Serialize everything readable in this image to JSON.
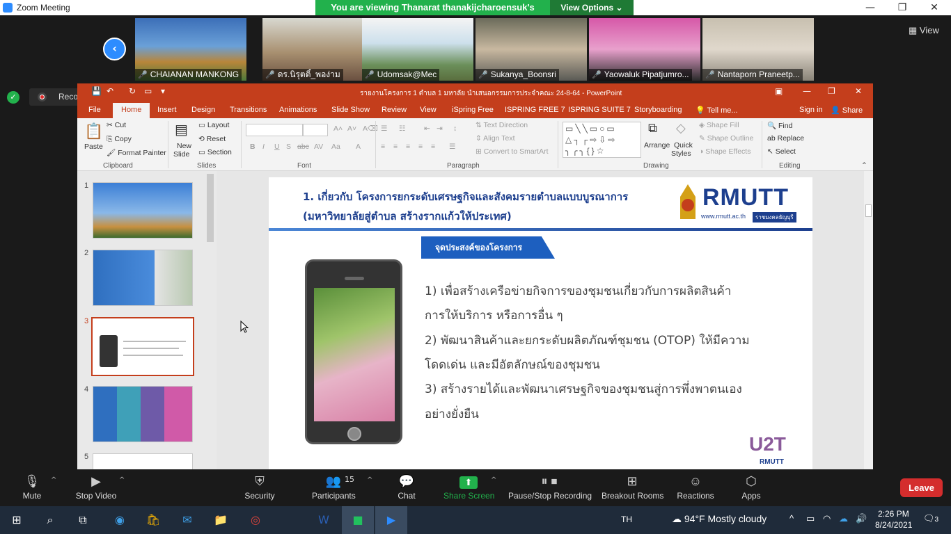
{
  "zoom": {
    "window_title": "Zoom Meeting",
    "viewing_banner": "You are viewing Thanarat thanakijcharoensuk's screen",
    "view_options": "View Options",
    "gallery_view_label": "View",
    "recording_label": "Recording..."
  },
  "participants": [
    {
      "name": "CHAIANAN MANKONG"
    },
    {
      "name": "ดร.นิรุตติ์_พอง่าม"
    },
    {
      "name": "Udomsak@Mec"
    },
    {
      "name": "Sukanya_Boonsri"
    },
    {
      "name": "Yaowaluk Pipatjumro..."
    },
    {
      "name": "Nantaporn Praneetp..."
    }
  ],
  "ppt": {
    "doc_title": "รายงานโครงการ 1 ตำบล 1 มหาลัย นำเสนอกรรมการประจำคณะ 24-8-64 - PowerPoint",
    "tabs": [
      "File",
      "Home",
      "Insert",
      "Design",
      "Transitions",
      "Animations",
      "Slide Show",
      "Review",
      "View",
      "iSpring Free",
      "ISPRING FREE 7",
      "ISPRING SUITE 7",
      "Storyboarding",
      "Tell me...",
      "Sign in",
      "Share"
    ],
    "ribbon": {
      "clipboard": {
        "paste": "Paste",
        "cut": "Cut",
        "copy": "Copy",
        "format_painter": "Format Painter",
        "group": "Clipboard"
      },
      "slides": {
        "new_slide": "New",
        "new_slide2": "Slide",
        "layout": "Layout",
        "reset": "Reset",
        "section": "Section",
        "group": "Slides"
      },
      "font": {
        "group": "Font"
      },
      "paragraph": {
        "text_direction": "Text Direction",
        "align_text": "Align Text",
        "convert": "Convert to SmartArt",
        "group": "Paragraph"
      },
      "drawing": {
        "arrange": "Arrange",
        "quick_styles": "Quick",
        "quick_styles2": "Styles",
        "shape_fill": "Shape Fill",
        "shape_outline": "Shape Outline",
        "shape_effects": "Shape Effects",
        "group": "Drawing"
      },
      "editing": {
        "find": "Find",
        "replace": "Replace",
        "select": "Select",
        "group": "Editing"
      }
    },
    "thumbnails": [
      "1",
      "2",
      "3",
      "4",
      "5"
    ],
    "slide": {
      "title_line1": "1. เกี่ยวกับ โครงการยกระดับเศรษฐกิจและสังคมรายตำบลแบบบูรณาการ",
      "title_line2": "(มหาวิทยาลัยสู่ตำบล สร้างรากแก้วให้ประเทศ)",
      "logo_word": "RMUTT",
      "logo_url": "www.rmutt.ac.th",
      "logo_tag": "ราชมงคลธัญบุรี",
      "objective_tag": "จุดประสงค์ของโครงการ",
      "objectives": [
        "1) เพื่อสร้างเครือข่ายกิจการของชุมชนเกี่ยวกับการผลิตสินค้า",
        "การให้บริการ  หรือการอื่น ๆ",
        "2) พัฒนาสินค้าและยกระดับผลิตภัณฑ์ชุมชน (OTOP) ให้มีความ",
        "โดดเด่น และมีอัตลักษณ์ของชุมชน",
        "3) สร้างรายได้และพัฒนาเศรษฐกิจของชุมชนสู่การพึ่งพาตนเอง",
        "อย่างยั่งยืน"
      ],
      "u2t": "U2T",
      "u2t_sub": "RMUTT"
    }
  },
  "toolbar": {
    "mute": "Mute",
    "stop_video": "Stop Video",
    "security": "Security",
    "participants": "Participants",
    "participants_count": "15",
    "chat": "Chat",
    "share_screen": "Share Screen",
    "pause_recording": "Pause/Stop Recording",
    "breakout": "Breakout Rooms",
    "reactions": "Reactions",
    "apps": "Apps",
    "leave": "Leave"
  },
  "taskbar": {
    "lang": "TH",
    "weather": "94°F  Mostly cloudy",
    "time": "2:26 PM",
    "date": "8/24/2021",
    "notifications": "3"
  },
  "colors": {
    "zoom_blue": "#2d8cff",
    "ppt_orange": "#c43e1c",
    "banner_green": "#22b14c",
    "leave_red": "#d42d2d",
    "rmutt_blue": "#1d3f8e"
  }
}
